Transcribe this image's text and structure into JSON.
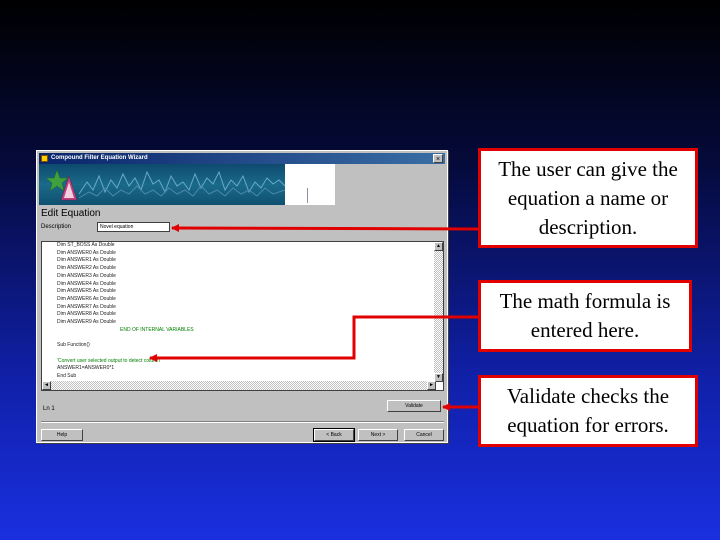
{
  "window": {
    "title": "Compound Filter Equation Wizard",
    "close_glyph": "×",
    "section_title": "Edit Equation",
    "description_label": "Description",
    "description_value": "Novel equation",
    "code_lines": [
      {
        "text": "Dim ST_BOSS As Double",
        "style": "normal"
      },
      {
        "text": "Dim ANSWER0 As Double",
        "style": "normal"
      },
      {
        "text": "Dim ANSWER1 As Double",
        "style": "normal"
      },
      {
        "text": "Dim ANSWER2 As Double",
        "style": "normal"
      },
      {
        "text": "Dim ANSWER3 As Double",
        "style": "normal"
      },
      {
        "text": "Dim ANSWER4 As Double",
        "style": "normal"
      },
      {
        "text": "Dim ANSWER5 As Double",
        "style": "normal"
      },
      {
        "text": "Dim ANSWER6 As Double",
        "style": "normal"
      },
      {
        "text": "Dim ANSWER7 As Double",
        "style": "normal"
      },
      {
        "text": "Dim ANSWER8 As Double",
        "style": "normal"
      },
      {
        "text": "Dim ANSWER9 As Double",
        "style": "normal"
      },
      {
        "text": "END OF INTERNAL VARIABLES",
        "style": "green-indent"
      },
      {
        "text": "",
        "style": "normal"
      },
      {
        "text": "Sub Function()",
        "style": "normal"
      },
      {
        "text": "",
        "style": "normal"
      },
      {
        "text": "'Convert user selected output to detect column",
        "style": "green"
      },
      {
        "text": "ANSWER1=ANSWER0*1",
        "style": "normal"
      },
      {
        "text": "End Sub",
        "style": "normal"
      }
    ],
    "status_text": "Ln 1",
    "validate_label": "Validate",
    "help_label": "Help",
    "back_label": "< Back",
    "next_label": "Next >",
    "cancel_label": "Cancel",
    "scroll_up": "▲",
    "scroll_down": "▼",
    "scroll_left": "◄",
    "scroll_right": "►"
  },
  "callouts": {
    "name": "The user can give the equation a name or description.",
    "formula": "The math formula is entered here.",
    "validate": "Validate checks the equation for errors."
  },
  "colors": {
    "callout_border": "#e00000",
    "background_bottom": "#1a30e0",
    "titlebar": "#0a246a"
  }
}
